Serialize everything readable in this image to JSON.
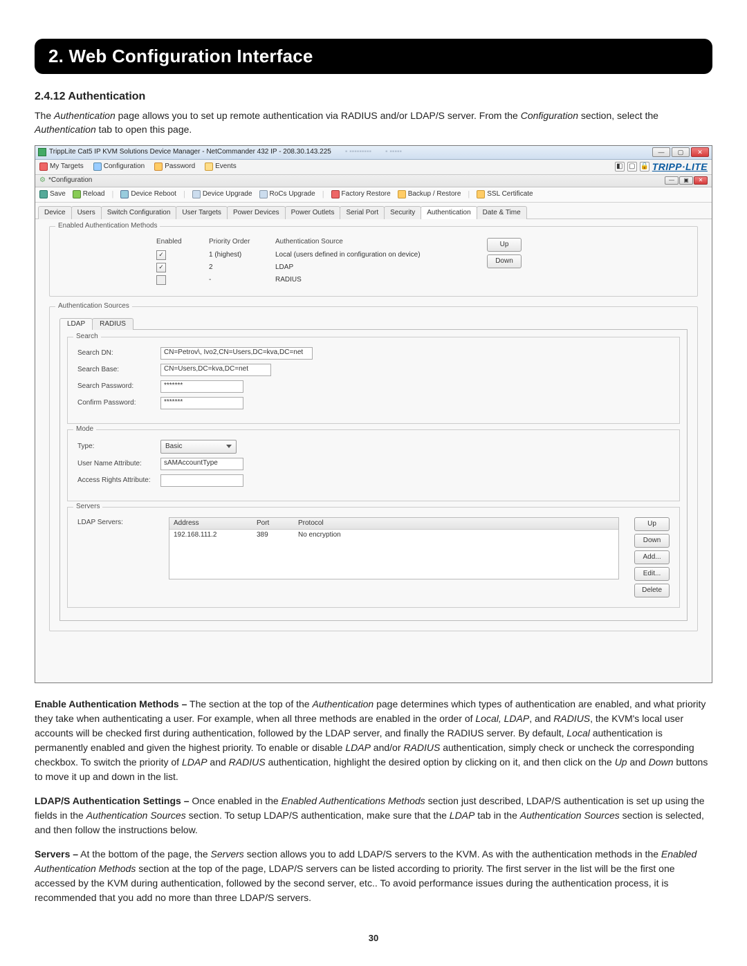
{
  "banner": "2. Web Configuration Interface",
  "subhead": "2.4.12 Authentication",
  "intro_html": "The <em>Authentication</em> page allows you to set up remote authentication via RADIUS and/or LDAP/S server. From the <em>Configuration</em> section, select the <em>Authentication</em> tab to open this page.",
  "window": {
    "title": "TrippLite Cat5 IP KVM Solutions Device Manager - NetCommander 432 IP - 208.30.143.225",
    "min": "—",
    "max": "▢",
    "close": "✕"
  },
  "toolbar1": {
    "items": [
      "My Targets",
      "Configuration",
      "Password",
      "Events"
    ],
    "brand": "TRIPP·LITE"
  },
  "config_label": "*Configuration",
  "toolbar2": [
    "Save",
    "Reload",
    "Device Reboot",
    "Device Upgrade",
    "RoCs Upgrade",
    "Factory Restore",
    "Backup / Restore",
    "SSL Certificate"
  ],
  "tabs": [
    "Device",
    "Users",
    "Switch Configuration",
    "User Targets",
    "Power Devices",
    "Power Outlets",
    "Serial Port",
    "Security",
    "Authentication",
    "Date & Time"
  ],
  "active_tab": "Authentication",
  "enabled_methods": {
    "legend": "Enabled Authentication Methods",
    "head": {
      "enabled": "Enabled",
      "priority": "Priority Order",
      "source": "Authentication Source"
    },
    "rows": [
      {
        "checked": true,
        "priority": "1 (highest)",
        "source": "Local (users defined in configuration on device)"
      },
      {
        "checked": true,
        "priority": "2",
        "source": "LDAP"
      },
      {
        "checked": false,
        "priority": "-",
        "source": "RADIUS"
      }
    ],
    "up": "Up",
    "down": "Down"
  },
  "auth_sources": {
    "legend": "Authentication Sources",
    "tabs": {
      "ldap": "LDAP",
      "radius": "RADIUS"
    },
    "search": {
      "legend": "Search",
      "dn_label": "Search DN:",
      "dn_value": "CN=Petrov\\, Ivo2,CN=Users,DC=kva,DC=net",
      "base_label": "Search Base:",
      "base_value": "CN=Users,DC=kva,DC=net",
      "pw_label": "Search Password:",
      "pw_value": "*******",
      "cpw_label": "Confirm Password:",
      "cpw_value": "*******"
    },
    "mode": {
      "legend": "Mode",
      "type_label": "Type:",
      "type_value": "Basic",
      "user_attr_label": "User Name Attribute:",
      "user_attr_value": "sAMAccountType",
      "rights_attr_label": "Access Rights Attribute:",
      "rights_attr_value": ""
    },
    "servers": {
      "legend": "Servers",
      "label": "LDAP Servers:",
      "head": {
        "addr": "Address",
        "port": "Port",
        "proto": "Protocol"
      },
      "rows": [
        {
          "addr": "192.168.111.2",
          "port": "389",
          "proto": "No encryption"
        }
      ],
      "btns": {
        "up": "Up",
        "down": "Down",
        "add": "Add...",
        "edit": "Edit...",
        "delete": "Delete"
      }
    }
  },
  "para1_html": "<b>Enable Authentication Methods –</b> The section at the top of the <em>Authentication</em> page determines which types of authentication are enabled, and what priority they take when authenticating a user. For example, when all three methods are enabled in the order of <em>Local, LDAP</em>, and <em>RADIUS</em>, the KVM's local user accounts will be checked first during authentication, followed by the LDAP server, and finally the RADIUS server. By default, <em>Local</em> authentication is permanently enabled and given the highest priority. To enable or disable <em>LDAP</em> and/or <em>RADIUS</em> authentication, simply check or uncheck the corresponding checkbox. To switch the priority of <em>LDAP</em> and <em>RADIUS</em> authentication, highlight the desired option by clicking on it, and then click on the <em>Up</em> and <em>Down</em> buttons to move it up and down in the list.",
  "para2_html": "<b>LDAP/S Authentication Settings –</b> Once enabled in the <em>Enabled Authentications Methods</em> section just described, LDAP/S authentication is set up using the fields in the <em>Authentication Sources</em> section. To setup LDAP/S authentication, make sure that the <em>LDAP</em> tab in the <em>Authentication Sources</em> section is selected, and then follow the instructions below.",
  "para3_html": "<b>Servers –</b> At the bottom of the page, the <em>Servers</em> section allows you to add LDAP/S servers to the KVM. As with the authentication methods in the <em>Enabled Authentication Methods</em> section at the top of the page, LDAP/S servers can be listed according to priority. The first server in the list will be the first one accessed by the KVM during authentication, followed by the second server, etc.. To avoid performance issues during the authentication process, it is recommended that you add no more than three LDAP/S servers.",
  "page_number": "30"
}
